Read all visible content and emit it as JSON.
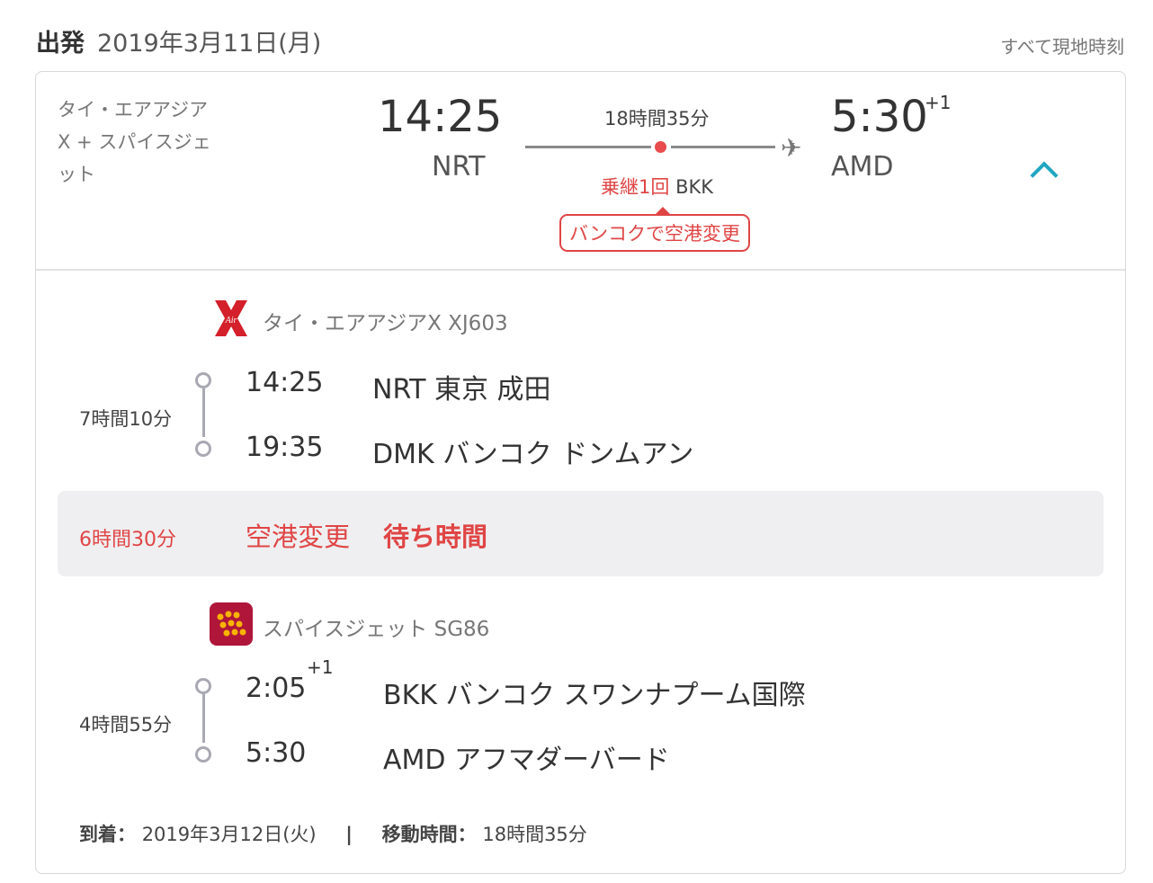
{
  "header": {
    "label": "出発",
    "date": "2019年3月11日(月)",
    "timezone_note": "すべて現地時刻"
  },
  "summary": {
    "carrier": "タイ・エアアジアX + スパイスジェット",
    "departure_time": "14:25",
    "departure_code": "NRT",
    "duration": "18時間35分",
    "stops_label": "乗継1回",
    "stop_code": "BKK",
    "airport_change_badge": "バンコクで空港変更",
    "arrival_time": "5:30",
    "arrival_day_offset": "+1",
    "arrival_code": "AMD",
    "collapse_icon": "chevron-up-icon",
    "plane_icon": "plane-icon"
  },
  "segments": [
    {
      "airline_logo": "airasia-x-logo",
      "flight": "タイ・エアアジアX XJ603",
      "duration": "7時間10分",
      "departure_time": "14:25",
      "departure_airport": "NRT 東京 成田",
      "arrival_time": "19:35",
      "arrival_airport": "DMK バンコク ドンムアン"
    },
    {
      "airline_logo": "spicejet-logo",
      "flight": "スパイスジェット SG86",
      "duration": "4時間55分",
      "departure_time": "2:05",
      "departure_day_offset": "+1",
      "departure_airport": "BKK バンコク スワンナプーム国際",
      "arrival_time": "5:30",
      "arrival_airport": "AMD アフマダーバード"
    }
  ],
  "layover": {
    "duration": "6時間30分",
    "airport_change": "空港変更",
    "wait": "待ち時間"
  },
  "footer": {
    "arrival_label": "到着：",
    "arrival_date": "2019年3月12日(火)",
    "separator": "|",
    "travel_time_label": "移動時間：",
    "travel_time": "18時間35分"
  },
  "colors": {
    "accent_red": "#e04545",
    "chevron_teal": "#1fa7c0",
    "timeline_gray": "#a9a9b4",
    "layover_bg": "#efeff1"
  }
}
